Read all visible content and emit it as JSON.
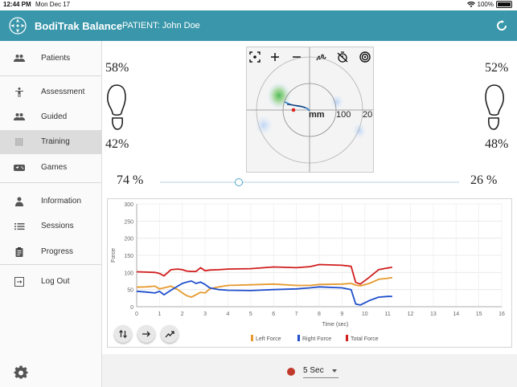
{
  "status_bar": {
    "time": "12:44 PM",
    "date": "Mon Dec 17",
    "battery": "100%"
  },
  "app": {
    "title": "BodiTrak Balance",
    "patient": "PATIENT: John Doe",
    "accent_color": "#3a97ab"
  },
  "sidebar": {
    "items": [
      {
        "label": "Patients",
        "icon": "people-icon"
      },
      {
        "label": "Assessment",
        "icon": "person-standing-icon"
      },
      {
        "label": "Guided",
        "icon": "people-icon"
      },
      {
        "label": "Training",
        "icon": "grid-dots-icon",
        "active": true
      },
      {
        "label": "Games",
        "icon": "gamepad-icon"
      },
      {
        "label": "Information",
        "icon": "person-icon"
      },
      {
        "label": "Sessions",
        "icon": "list-icon"
      },
      {
        "label": "Progress",
        "icon": "clipboard-icon"
      },
      {
        "label": "Log Out",
        "icon": "logout-icon"
      }
    ]
  },
  "balance": {
    "left_top": "58%",
    "left_bottom": "42%",
    "right_top": "52%",
    "right_bottom": "48%",
    "left_split": "74 %",
    "right_split": "26 %",
    "split_value": 0.26
  },
  "radar": {
    "unit_label": "mm",
    "ring_label_1": "100",
    "ring_label_2": "20"
  },
  "chart_data": {
    "type": "line",
    "ylabel": "Force",
    "xlabel": "Time (sec)",
    "ylim": [
      0,
      300
    ],
    "xlim": [
      0,
      16
    ],
    "yticks": [
      0,
      50,
      100,
      150,
      200,
      250,
      300
    ],
    "xticks": [
      0,
      1,
      2,
      3,
      4,
      5,
      6,
      7,
      8,
      9,
      10,
      11,
      12,
      13,
      14,
      15,
      16
    ],
    "grid": true,
    "legend_position": "bottom",
    "series": [
      {
        "name": "Left Force",
        "color": "#e69a2e",
        "x": [
          0,
          0.4,
          0.8,
          1.0,
          1.2,
          1.5,
          1.8,
          2.0,
          2.2,
          2.4,
          2.6,
          2.8,
          3.0,
          3.2,
          3.6,
          4.0,
          5.0,
          6.0,
          7.0,
          7.6,
          8.0,
          9.0,
          9.4,
          9.6,
          9.8,
          10.2,
          10.6,
          11.0,
          11.2
        ],
        "y": [
          57,
          58,
          60,
          52,
          55,
          60,
          50,
          40,
          32,
          28,
          35,
          42,
          40,
          52,
          58,
          62,
          64,
          66,
          62,
          62,
          65,
          66,
          68,
          63,
          61,
          68,
          80,
          83,
          85
        ]
      },
      {
        "name": "Right Force",
        "color": "#1f4fcc",
        "x": [
          0,
          0.4,
          0.8,
          1.0,
          1.2,
          1.5,
          1.8,
          2.0,
          2.2,
          2.4,
          2.6,
          2.8,
          3.0,
          3.2,
          3.6,
          4.0,
          5.0,
          6.0,
          7.0,
          7.6,
          8.0,
          9.0,
          9.4,
          9.6,
          9.8,
          10.2,
          10.6,
          11.0,
          11.2
        ],
        "y": [
          45,
          43,
          40,
          45,
          35,
          48,
          60,
          68,
          72,
          75,
          68,
          72,
          65,
          55,
          50,
          48,
          47,
          50,
          52,
          55,
          58,
          55,
          50,
          8,
          5,
          18,
          28,
          30,
          30
        ]
      },
      {
        "name": "Total Force",
        "color": "#d11d1d",
        "x": [
          0,
          0.4,
          0.8,
          1.0,
          1.2,
          1.5,
          1.8,
          2.0,
          2.2,
          2.4,
          2.6,
          2.8,
          3.0,
          3.2,
          3.6,
          4.0,
          5.0,
          6.0,
          7.0,
          7.6,
          8.0,
          9.0,
          9.4,
          9.6,
          9.8,
          10.2,
          10.6,
          11.0,
          11.2
        ],
        "y": [
          102,
          101,
          100,
          97,
          90,
          108,
          110,
          108,
          104,
          103,
          103,
          114,
          105,
          107,
          108,
          110,
          111,
          116,
          114,
          117,
          123,
          121,
          118,
          71,
          66,
          86,
          108,
          113,
          115
        ]
      }
    ]
  },
  "controls": {
    "duration": "5 Sec",
    "record_color": "#c0392b"
  }
}
